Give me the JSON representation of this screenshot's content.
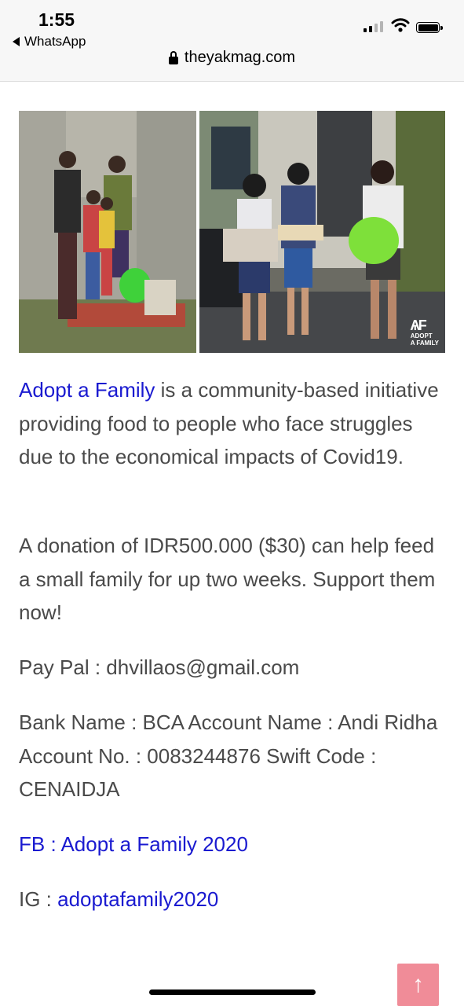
{
  "status_bar": {
    "time": "1:55",
    "back_app": "WhatsApp"
  },
  "browser": {
    "url": "theyakmag.com"
  },
  "photos": {
    "logo_text_line1": "ADOPT",
    "logo_text_line2": "A FAMILY",
    "logo_mark": "AAF"
  },
  "article": {
    "intro_link": "Adopt a Family",
    "intro_rest": " is a community-based initiative providing food to people who face struggles due to the economical impacts of Covid19.",
    "donation": "A donation of IDR500.000 ($30) can help feed a small family for up two weeks. Support them now!",
    "paypal": "Pay Pal : dhvillaos@gmail.com",
    "bank": "Bank Name : BCA Account Name : Andi Ridha Account No. : 0083244876 Swift Code : CENAIDJA",
    "fb_link": "FB : Adopt a Family 2020",
    "ig_label": "IG : ",
    "ig_link": "adoptafamily2020"
  },
  "back_to_top": {
    "icon": "arrow-up-icon",
    "glyph": "↑",
    "color": "#f08c98"
  },
  "colors": {
    "link": "#1a1ad0",
    "text": "#4a4a4a"
  }
}
